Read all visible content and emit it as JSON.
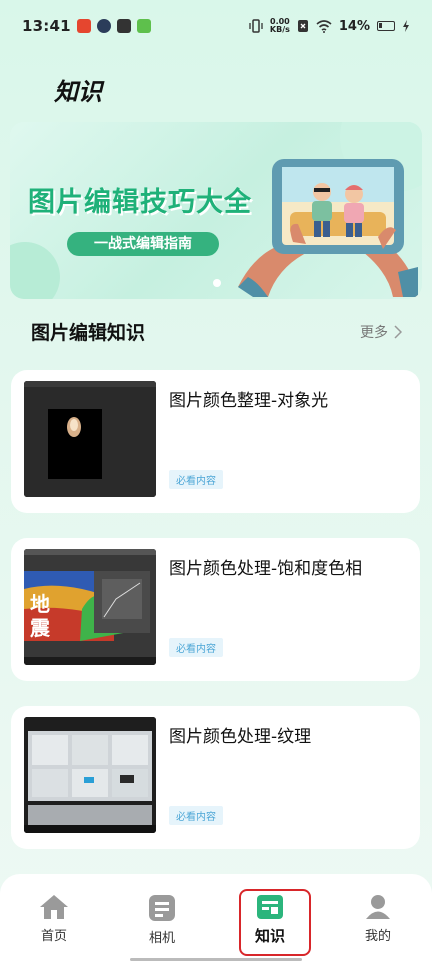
{
  "status_bar": {
    "time": "13:41",
    "net_speed_value": "0.00",
    "net_speed_unit": "KB/s",
    "battery": "14%"
  },
  "page": {
    "title": "知识"
  },
  "banner": {
    "title": "图片编辑技巧大全",
    "subtitle": "一战式编辑指南"
  },
  "section": {
    "title": "图片编辑知识",
    "more_label": "更多"
  },
  "articles": [
    {
      "title": "图片颜色整理-对象光",
      "tag": "必看内容"
    },
    {
      "title": "图片颜色处理-饱和度色相",
      "tag": "必看内容"
    },
    {
      "title": "图片颜色处理-纹理",
      "tag": "必看内容"
    }
  ],
  "nav": {
    "items": [
      {
        "label": "首页",
        "icon": "home-icon"
      },
      {
        "label": "相机",
        "icon": "camera-icon"
      },
      {
        "label": "知识",
        "icon": "knowledge-icon",
        "active": true
      },
      {
        "label": "我的",
        "icon": "profile-icon"
      }
    ],
    "active_color": "#2bb57c",
    "inactive_color": "#9a9a9a"
  },
  "colors": {
    "accent": "#35b27f",
    "highlight_box": "#d8262a",
    "tag_text": "#4ca6d6"
  }
}
